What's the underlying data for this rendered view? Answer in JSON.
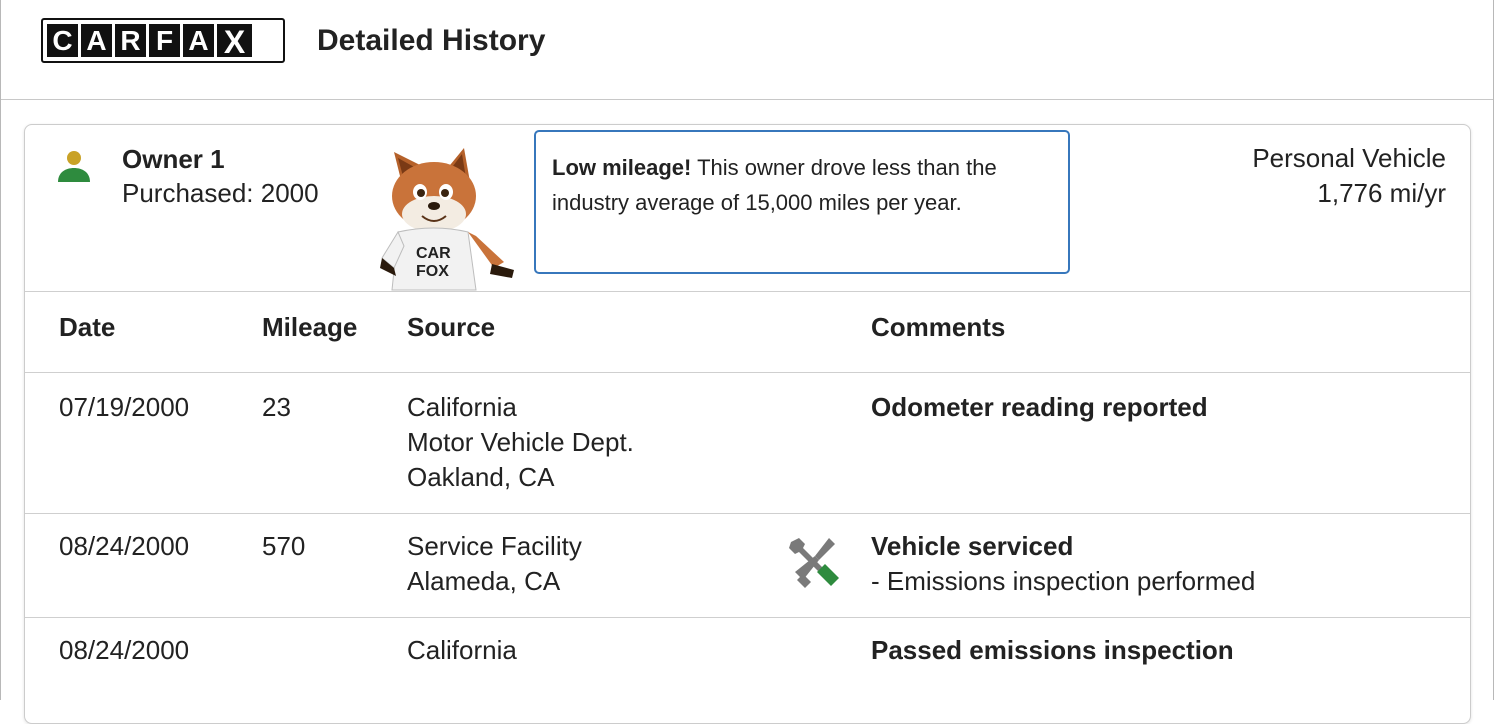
{
  "header": {
    "logo_letters": [
      "C",
      "A",
      "R",
      "F",
      "A",
      "X"
    ],
    "title": "Detailed History"
  },
  "owner": {
    "name": "Owner 1",
    "purchased": "Purchased: 2000",
    "callout_bold": "Low mileage!",
    "callout_text": " This owner drove less than the industry average of 15,000 miles per year.",
    "vehicle_type": "Personal Vehicle",
    "annual_mileage": "1,776 mi/yr",
    "mascot_shirt": [
      "CAR",
      "FOX"
    ]
  },
  "table": {
    "columns": [
      "Date",
      "Mileage",
      "Source",
      "Comments"
    ],
    "rows": [
      {
        "date": "07/19/2000",
        "mileage": "23",
        "source": [
          "California",
          "Motor Vehicle Dept.",
          "Oakland, CA"
        ],
        "comment_title": "Odometer reading reported",
        "comment_detail": "",
        "icon": ""
      },
      {
        "date": "08/24/2000",
        "mileage": "570",
        "source": [
          "Service Facility",
          "Alameda, CA"
        ],
        "comment_title": "Vehicle serviced",
        "comment_detail": "- Emissions inspection performed",
        "icon": "wrench-screwdriver-icon"
      },
      {
        "date": "08/24/2000",
        "mileage": "",
        "source": [
          "California"
        ],
        "comment_title": "Passed emissions inspection",
        "comment_detail": "",
        "icon": ""
      }
    ]
  },
  "colors": {
    "callout_border": "#3777bc",
    "owner_icon_head": "#c9a227",
    "owner_icon_body": "#2e8b3e",
    "service_icon_green": "#2e8b3e",
    "service_icon_gray": "#7a7a7a"
  }
}
